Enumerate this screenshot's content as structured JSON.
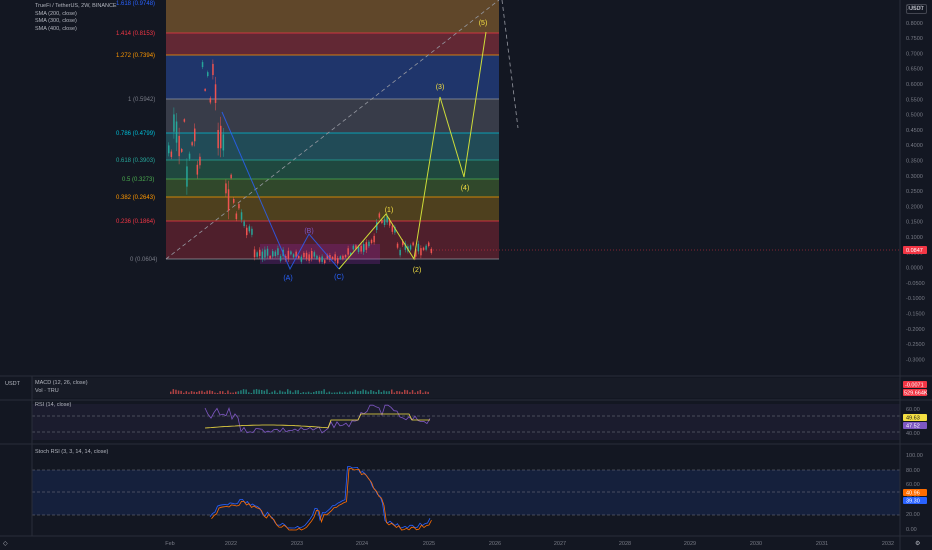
{
  "header": {
    "title": "TrueFi / TetherUS, 2W, BINANCE",
    "indicators": [
      "SMA (200, close)",
      "SMA (300, close)",
      "SMA (400, close)"
    ]
  },
  "currency_label": "USDT",
  "left_currency_label": "USDT",
  "price_axis": {
    "ticks": [
      "0.8500",
      "0.8000",
      "0.7500",
      "0.7000",
      "0.6500",
      "0.6000",
      "0.5500",
      "0.5000",
      "0.4500",
      "0.4000",
      "0.3500",
      "0.3000",
      "0.2500",
      "0.2000",
      "0.1500",
      "0.1000",
      "0.0500",
      "0.0000",
      "-0.0500",
      "-0.1000",
      "-0.1500",
      "-0.2000",
      "-0.2500",
      "-0.3000"
    ],
    "current_price": "0.0847"
  },
  "fib_levels": [
    {
      "label": "1.618 (0.9748)",
      "color": "#2962ff"
    },
    {
      "label": "1.414 (0.8153)",
      "color": "#f23645"
    },
    {
      "label": "1.272 (0.7394)",
      "color": "#ff9800"
    },
    {
      "label": "1 (0.5942)",
      "color": "#787b86"
    },
    {
      "label": "0.786 (0.4799)",
      "color": "#00bcd4"
    },
    {
      "label": "0.618 (0.3903)",
      "color": "#26a69a"
    },
    {
      "label": "0.5 (0.3273)",
      "color": "#4caf50"
    },
    {
      "label": "0.382 (0.2643)",
      "color": "#ff9800"
    },
    {
      "label": "0.236 (0.1864)",
      "color": "#f23645"
    },
    {
      "label": "0 (0.0604)",
      "color": "#787b86"
    }
  ],
  "wave_labels": {
    "corrective": [
      "(A)",
      "(B)",
      "(C)"
    ],
    "impulse": [
      "(1)",
      "(2)",
      "(3)",
      "(4)",
      "(5)"
    ]
  },
  "macd": {
    "label": "MACD (12, 26, close)",
    "vol_label": "Vol · TRU",
    "value1": "-0.0071",
    "value2": "529.664K"
  },
  "rsi": {
    "label": "RSI (14, close)",
    "ticks": [
      "60.00",
      "40.00"
    ],
    "value1": "49.63",
    "value2": "47.52"
  },
  "stoch": {
    "label": "Stoch RSI (3, 3, 14, 14, close)",
    "ticks": [
      "100.00",
      "80.00",
      "60.00",
      "40.00",
      "20.00",
      "0.00"
    ],
    "k_value": "40.96",
    "d_value": "39.30"
  },
  "time_axis": [
    "Feb",
    "2022",
    "2023",
    "2024",
    "2025",
    "2026",
    "2027",
    "2028",
    "2029",
    "2030",
    "2031",
    "2032"
  ]
}
